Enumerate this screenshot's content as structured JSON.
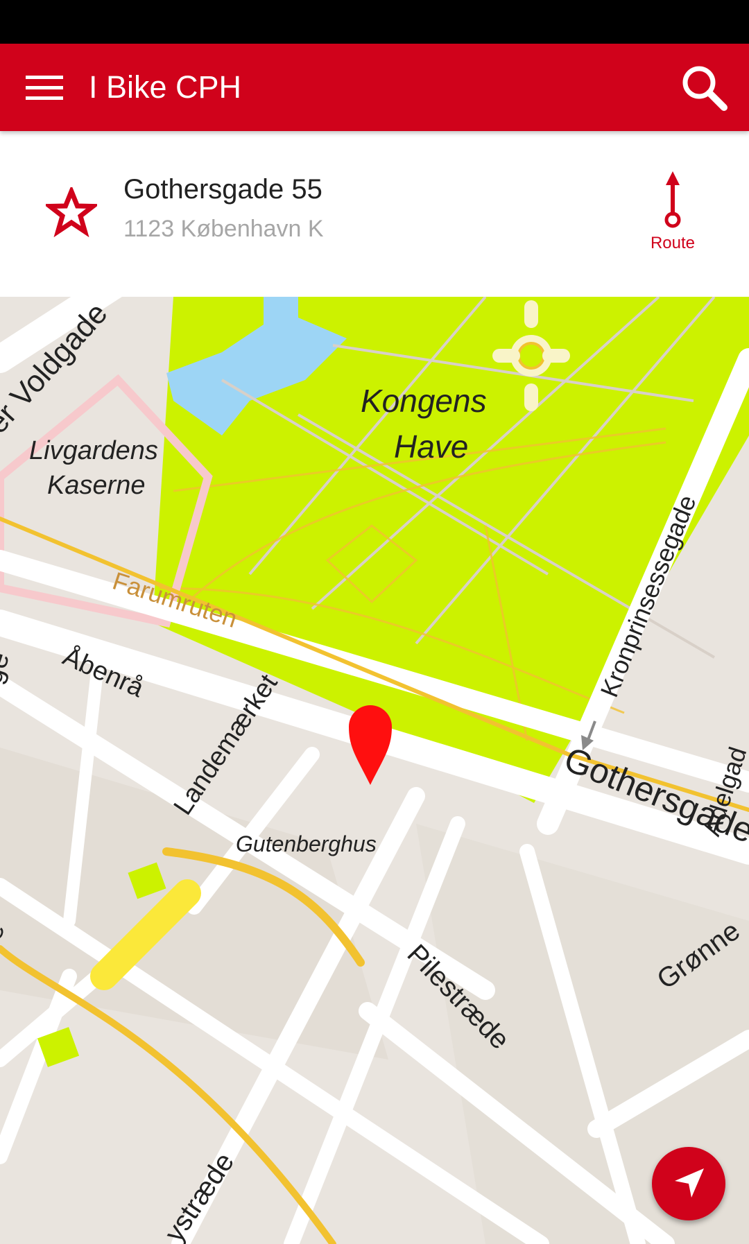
{
  "app_bar": {
    "title": "I Bike CPH",
    "menu_icon": "hamburger-menu-icon",
    "search_icon": "search-icon",
    "color": "#d0021b"
  },
  "address_card": {
    "street": "Gothersgade 55",
    "postal_city": "1123 København K",
    "favorite_icon": "star-outline-icon",
    "route_label": "Route",
    "route_icon": "route-arrow-icon"
  },
  "map": {
    "labels": {
      "park_line1": "Kongens",
      "park_line2": "Have",
      "barracks_line1": "Livgardens",
      "barracks_line2": "Kaserne",
      "voldgade": "er Voldgade",
      "farumruten": "Farumruten",
      "abenra": "Åbenrå",
      "landemaerket": "Landemærket",
      "gutenberghus": "Gutenberghus",
      "kronprinsessegade": "Kronprinsessegade",
      "adelgade": "Adelgad",
      "gothersgade": "Gothersgade",
      "pilestraede": "Pilestræde",
      "gronne": "Grønne",
      "straede": "ystræde",
      "left_edge_ge": "ge",
      "left_edge_e": "e"
    },
    "marker_icon": "map-pin-icon",
    "colors": {
      "park": "#ccf200",
      "water": "#9dd5f5",
      "land": "#e9e4de",
      "road": "#ffffff",
      "route": "#f2c230"
    }
  },
  "fab": {
    "icon": "navigation-arrow-icon"
  }
}
